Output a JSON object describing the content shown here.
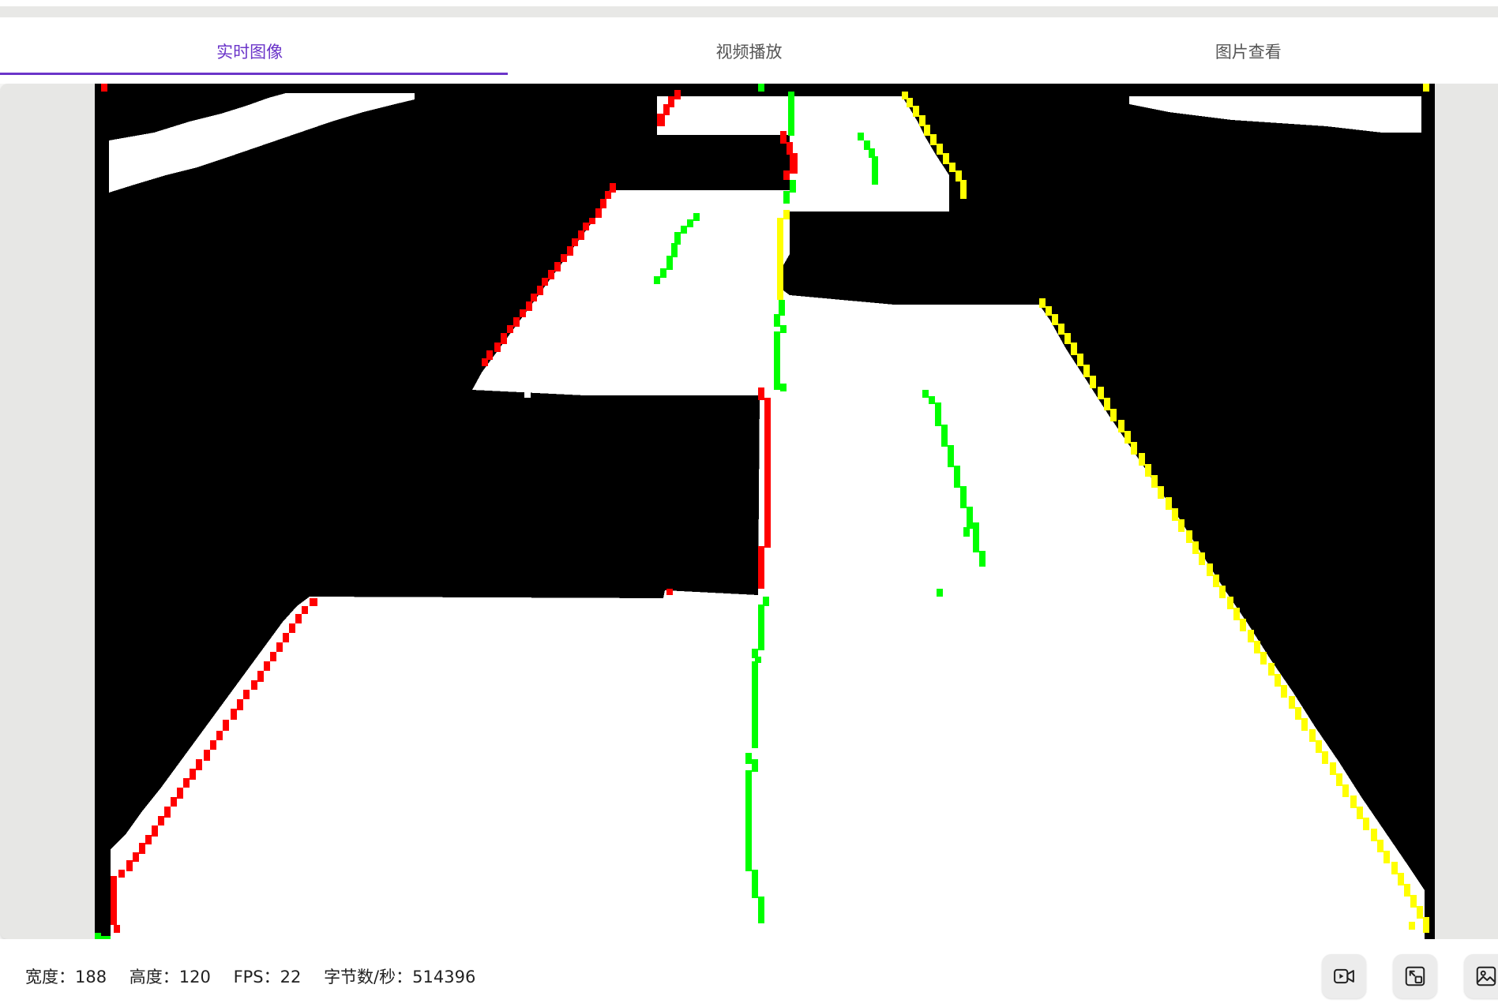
{
  "tabs": [
    {
      "label": "实时图像",
      "active": true
    },
    {
      "label": "视频播放",
      "active": false
    },
    {
      "label": "图片查看",
      "active": false
    }
  ],
  "colors": {
    "accent": "#6b35c9",
    "left_edge": "#ff0000",
    "center_line": "#00ff00",
    "right_edge": "#ffff00",
    "road": "#ffffff",
    "background": "#000000"
  },
  "status": {
    "width_label": "宽度：",
    "width_value": "188",
    "height_label": "高度：",
    "height_value": "120",
    "fps_label": "FPS：",
    "fps_value": "22",
    "bytes_label": "字节数/秒：",
    "bytes_value": "514396"
  },
  "toolbar": [
    {
      "name": "record-video-button",
      "icon": "video-camera-icon"
    },
    {
      "name": "fit-screen-button",
      "icon": "resize-icon"
    },
    {
      "name": "save-image-button",
      "icon": "image-icon"
    }
  ]
}
